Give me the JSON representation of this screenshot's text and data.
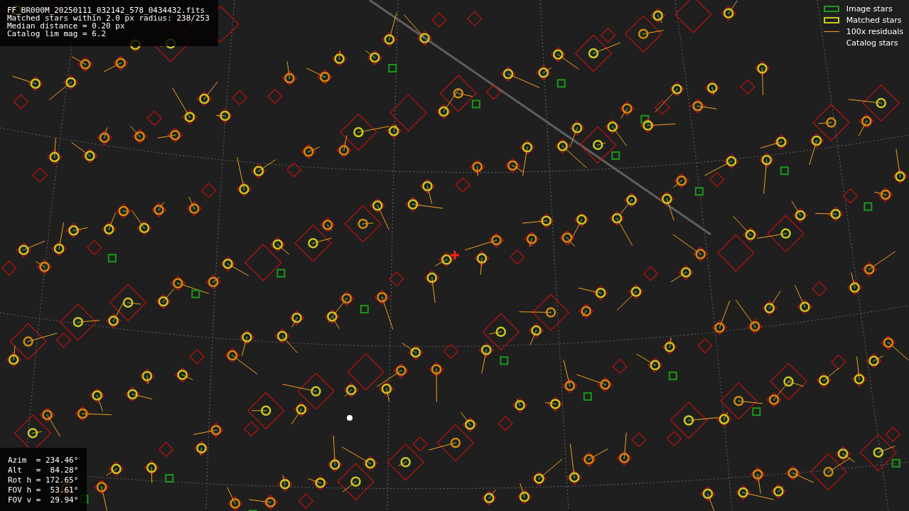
{
  "info": {
    "lines": [
      "FF_BR000M_20250111_032142_578_0434432.fits",
      "Matched stars within 2.0 px radius: 238/253",
      "Median distance = 0.20 px",
      "Catalog lim mag = 6.2"
    ]
  },
  "legend": [
    {
      "kind": "image",
      "label": "Image stars"
    },
    {
      "kind": "matched",
      "label": "Matched stars"
    },
    {
      "kind": "residual",
      "label": "100x residuals"
    },
    {
      "kind": "catalog",
      "label": "Catalog stars"
    }
  ],
  "pointing": {
    "lines": [
      "Azim  = 234.46°",
      "Alt   =  84.28°",
      "Rot h = 172.65°",
      "FOV h =  53.61°",
      "FOV v =  29.94°"
    ]
  }
}
